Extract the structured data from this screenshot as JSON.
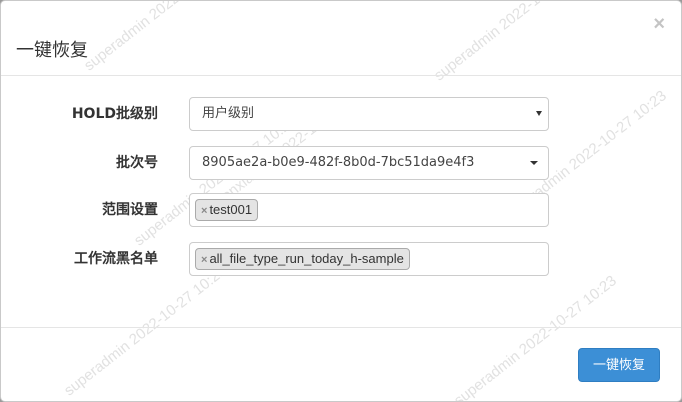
{
  "dialog": {
    "title": "一键恢复",
    "close_glyph": "×"
  },
  "form": {
    "hold_level": {
      "label": "HOLD批级别",
      "value": "用户级别"
    },
    "batch_no": {
      "label": "批次号",
      "value": "8905ae2a-b0e9-482f-8b0d-7bc51da9e4f3"
    },
    "scope": {
      "label": "范围设置",
      "tags": [
        "test001"
      ]
    },
    "workflow_blacklist": {
      "label": "工作流黑名单",
      "tags": [
        "all_file_type_run_today_h-sample"
      ]
    }
  },
  "footer": {
    "restore_button_label": "一键恢复"
  },
  "watermarks": [
    "superadmin 2022-10-27",
    "superadmin 2022-10-27 10:23",
    "superadmin 2022-10-27 10:23",
    "chenxiaohui 2022-10-27"
  ],
  "colors": {
    "primary": "#3c8fd6",
    "tag_bg": "#e4e4e4"
  }
}
